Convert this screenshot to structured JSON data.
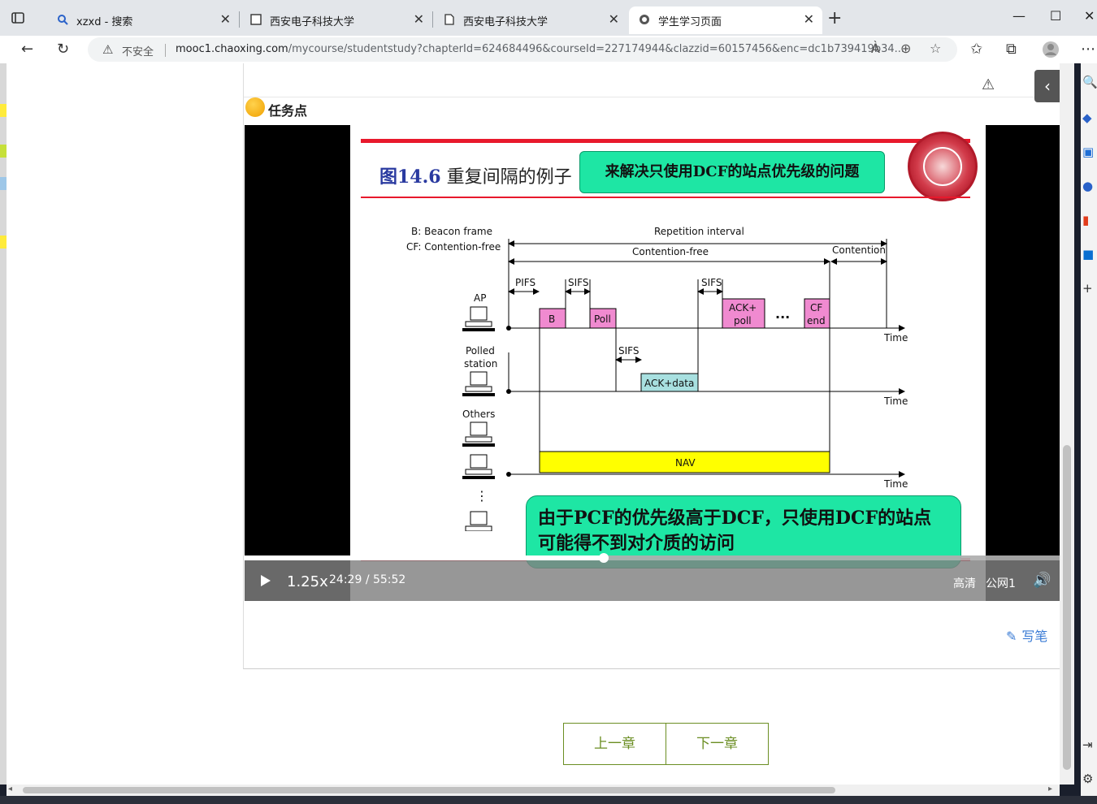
{
  "browser": {
    "tabs": [
      {
        "title": "xzxd - 搜索",
        "icon": "search-icon",
        "active": false
      },
      {
        "title": "西安电子科技大学",
        "icon": "page-icon",
        "active": false
      },
      {
        "title": "西安电子科技大学",
        "icon": "page-icon",
        "active": false
      },
      {
        "title": "学生学习页面",
        "icon": "globe-icon",
        "active": true
      }
    ],
    "address": {
      "security_label": "不安全",
      "host": "mooc1.chaoxing.com",
      "path": "/mycourse/studentstudy?chapterId=624684496&courseId=227174944&clazzid=60157456&enc=dc1b739419b34..."
    },
    "read_aloud_icon": "À"
  },
  "page": {
    "task_label": "任务点",
    "write_note_label": "写笔",
    "prev_chapter_label": "上一章",
    "next_chapter_label": "下一章"
  },
  "player": {
    "speed": "1.25x",
    "current_time": "24:29",
    "separator": "/",
    "duration": "55:52",
    "quality": "高清",
    "line": "公网1",
    "progress_fraction": 0.44
  },
  "slide": {
    "figure_number": "图14.6",
    "title": "重复间隔的例子",
    "tag": "来解决只使用DCF的站点优先级的问题",
    "diagram": {
      "legend_b": "B: Beacon frame",
      "legend_cf": "CF: Contention-free",
      "repetition_interval": "Repetition interval",
      "contention_free": "Contention-free",
      "contention": "Contention",
      "pifs": "PIFS",
      "sifs": "SIFS",
      "ap_label": "AP",
      "polled_label": "Polled",
      "station_label": "station",
      "others_label": "Others",
      "b_box": "B",
      "poll_box": "Poll",
      "ack_poll_1": "ACK+",
      "ack_poll_2": "poll",
      "ellipsis": "...",
      "cf_end_1": "CF",
      "cf_end_2": "end",
      "ack_data": "ACK+data",
      "nav": "NAV",
      "time": "Time",
      "vdots": "⋮"
    },
    "callout": "由于PCF的优先级高于DCF，只使用DCF的站点可能得不到对介质的访问"
  },
  "colors": {
    "accent_green": "#1ee6a4",
    "slide_red": "#e8192c",
    "pink_box": "#f08ad0",
    "teal_box": "#a8e0e0",
    "nav_yellow": "#ffff00",
    "chapter_button": "#6b8e23"
  }
}
